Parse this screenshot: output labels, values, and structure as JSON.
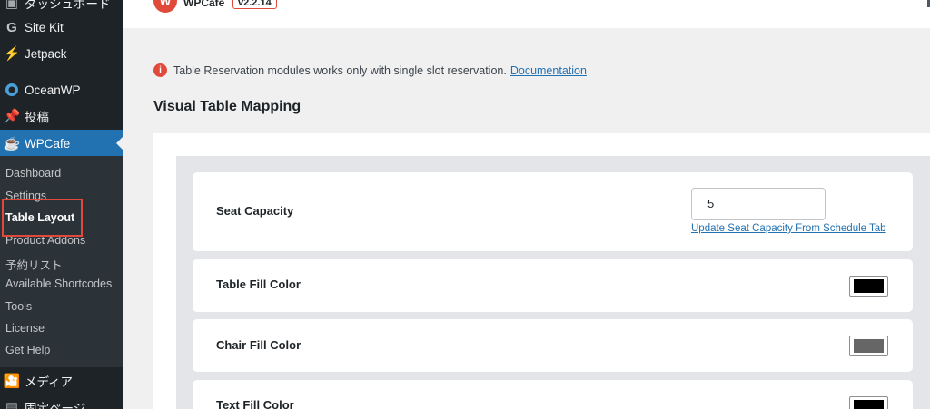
{
  "sidebar": {
    "items": [
      {
        "label": "ダッシュボード",
        "icon": "dashboard-icon"
      },
      {
        "label": "Site Kit",
        "icon": "site-kit-icon"
      },
      {
        "label": "Jetpack",
        "icon": "jetpack-icon"
      },
      {
        "label": "OceanWP",
        "icon": "oceanwp-icon"
      },
      {
        "label": "投稿",
        "icon": "pin-icon"
      },
      {
        "label": "WPCafe",
        "icon": "wpcafe-icon"
      },
      {
        "label": "メディア",
        "icon": "media-icon"
      },
      {
        "label": "固定ページ",
        "icon": "page-icon"
      }
    ],
    "submenu": [
      {
        "label": "Dashboard"
      },
      {
        "label": "Settings"
      },
      {
        "label": "Table Layout"
      },
      {
        "label": "Product Addons"
      },
      {
        "label": "予約リスト"
      },
      {
        "label": "Available Shortcodes"
      },
      {
        "label": "Tools"
      },
      {
        "label": "License"
      },
      {
        "label": "Get Help"
      }
    ]
  },
  "header": {
    "brand": "WPCafe",
    "version": "v2.2.14"
  },
  "notice": {
    "text": "Table Reservation modules works only with single slot reservation.",
    "link": "Documentation"
  },
  "page": {
    "title": "Visual Table Mapping"
  },
  "settings": {
    "seat_capacity": {
      "label": "Seat Capacity",
      "value": "5",
      "link": "Update Seat Capacity From Schedule Tab"
    },
    "table_fill": {
      "label": "Table Fill Color",
      "color": "#000000"
    },
    "chair_fill": {
      "label": "Chair Fill Color",
      "color": "#666666"
    },
    "text_fill": {
      "label": "Text Fill Color",
      "color": "#000000"
    }
  },
  "colors": {
    "sidebar_bg": "#1d2327",
    "submenu_bg": "#2c3338",
    "accent": "#2271b1",
    "brand_red": "#e04a3a"
  }
}
